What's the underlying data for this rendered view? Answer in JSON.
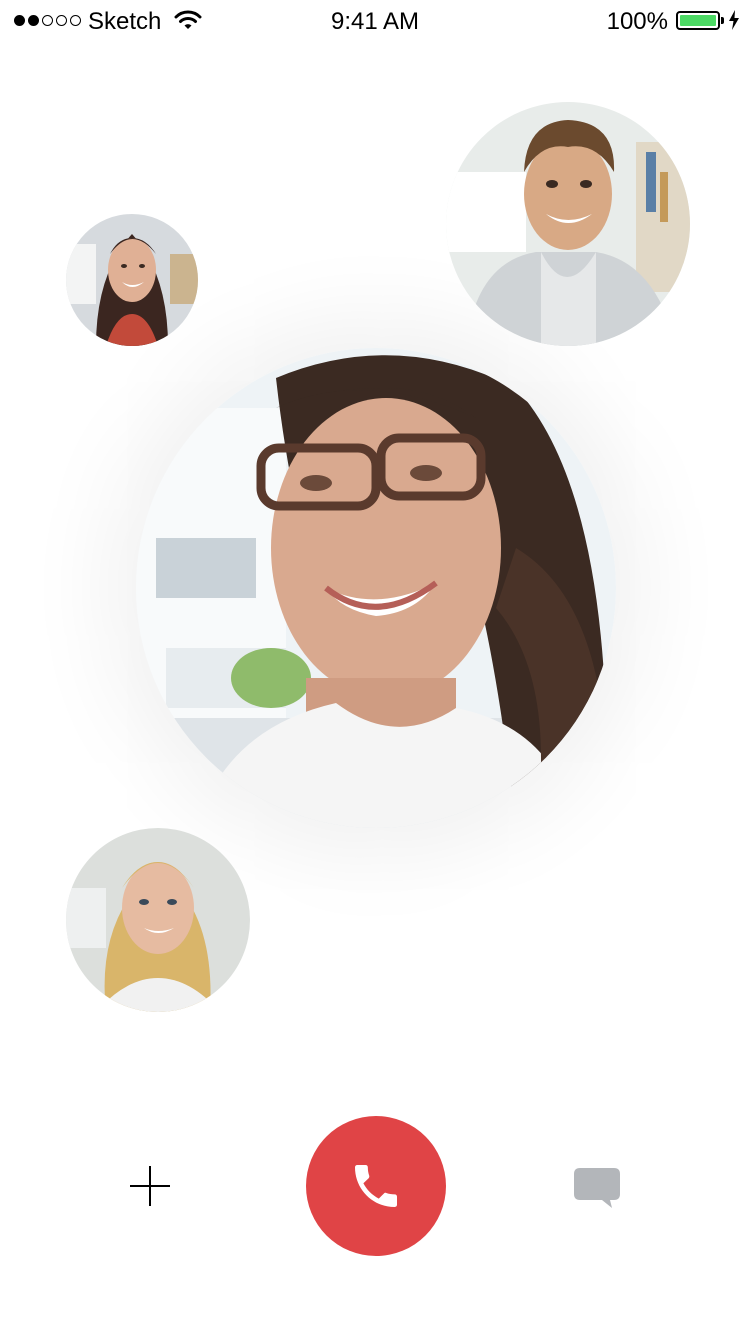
{
  "status_bar": {
    "carrier": "Sketch",
    "time": "9:41 AM",
    "battery_percent": "100%",
    "signal_strength": 2,
    "signal_total": 5,
    "icons": [
      "signal-dots-icon",
      "wifi-icon",
      "battery-icon",
      "charging-bolt-icon"
    ]
  },
  "call": {
    "participants": [
      {
        "role": "active-speaker",
        "icon": "woman-with-glasses-photo"
      },
      {
        "role": "participant",
        "icon": "man-smiling-photo"
      },
      {
        "role": "participant",
        "icon": "woman-dark-hair-photo"
      },
      {
        "role": "participant",
        "icon": "woman-blonde-hair-photo"
      }
    ]
  },
  "controls": {
    "add_icon": "plus-icon",
    "end_call_icon": "phone-icon",
    "chat_icon": "chat-bubble-icon"
  },
  "colors": {
    "end_call": "#e04446",
    "battery": "#4cd964",
    "chat_icon": "#b3b6ba"
  }
}
